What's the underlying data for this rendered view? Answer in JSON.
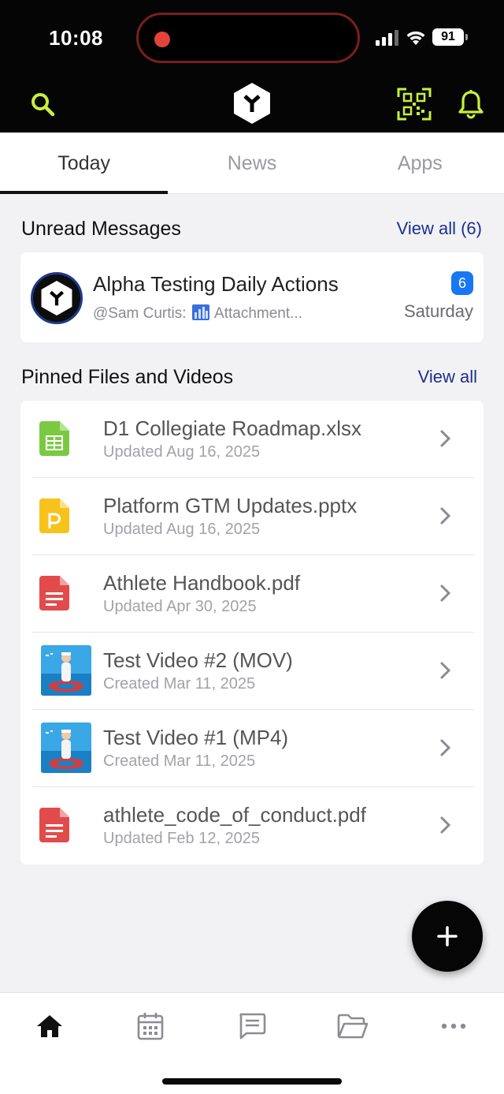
{
  "status_bar": {
    "time": "10:08",
    "battery": "91"
  },
  "header": {
    "search_icon": "search-icon",
    "logo_icon": "app-logo-icon",
    "qr_icon": "qr-code-icon",
    "bell_icon": "bell-icon",
    "accent_color": "#c8f03c"
  },
  "tabs": [
    {
      "label": "Today",
      "active": true
    },
    {
      "label": "News",
      "has_dot": true
    },
    {
      "label": "Apps"
    }
  ],
  "unread": {
    "title": "Unread Messages",
    "view_all": "View all (6)",
    "message": {
      "title": "Alpha Testing Daily Actions",
      "sender": "@Sam Curtis:",
      "preview": "Attachment...",
      "badge": "6",
      "date": "Saturday"
    }
  },
  "pinned": {
    "title": "Pinned Files and Videos",
    "view_all": "View all",
    "files": [
      {
        "name": "D1 Collegiate Roadmap.xlsx",
        "date": "Updated Aug 16, 2025",
        "icon": "spreadsheet-icon"
      },
      {
        "name": "Platform GTM Updates.pptx",
        "date": "Updated Aug 16, 2025",
        "icon": "presentation-icon"
      },
      {
        "name": "Athlete Handbook.pdf",
        "date": "Updated Apr 30, 2025",
        "icon": "pdf-icon"
      },
      {
        "name": "Test Video #2 (MOV)",
        "date": "Created Mar 11, 2025",
        "icon": "video-thumbnail"
      },
      {
        "name": "Test Video #1 (MP4)",
        "date": "Created Mar 11, 2025",
        "icon": "video-thumbnail"
      },
      {
        "name": "athlete_code_of_conduct.pdf",
        "date": "Updated Feb 12, 2025",
        "icon": "pdf-icon"
      }
    ]
  },
  "bottom_nav": [
    "home-icon",
    "calendar-icon",
    "chat-icon",
    "folder-icon",
    "more-icon"
  ],
  "colors": {
    "link": "#1b2f8f",
    "badge": "#1877f2",
    "excel": "#7bc943",
    "ppt": "#f7c21b",
    "pdf": "#e24b4b"
  }
}
